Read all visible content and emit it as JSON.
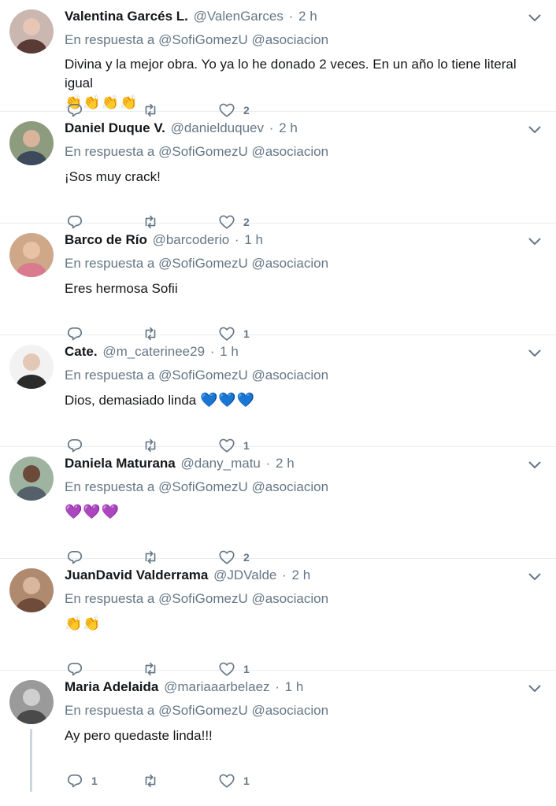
{
  "reply_prefix": "En respuesta a",
  "reply_targets": [
    "@SofiGomezU",
    "@asociacion"
  ],
  "tweets": [
    {
      "name": "Valentina Garcés L.",
      "handle": "@ValenGarces",
      "time": "2 h",
      "text": "Divina y la mejor obra. Yo ya lo he donado 2 veces. En un año lo tiene literal igual",
      "emoji": "👏👏👏👏",
      "replies": "",
      "retweets": "",
      "likes": "2"
    },
    {
      "name": "Daniel Duque V.",
      "handle": "@danielduquev",
      "time": "2 h",
      "text": "¡Sos muy crack!",
      "emoji": "",
      "replies": "",
      "retweets": "",
      "likes": "2"
    },
    {
      "name": "Barco de Río",
      "handle": "@barcoderio",
      "time": "1 h",
      "text": "Eres hermosa Sofii",
      "emoji": "",
      "replies": "",
      "retweets": "",
      "likes": "1"
    },
    {
      "name": "Cate.",
      "handle": "@m_caterinee29",
      "time": "1 h",
      "text": "Dios, demasiado linda",
      "emoji": "💙💙💙",
      "replies": "",
      "retweets": "",
      "likes": "1"
    },
    {
      "name": "Daniela Maturana",
      "handle": "@dany_matu",
      "time": "2 h",
      "text": "",
      "emoji": "💜💜💜",
      "replies": "",
      "retweets": "",
      "likes": "2"
    },
    {
      "name": "JuanDavid Valderrama",
      "handle": "@JDValde",
      "time": "2 h",
      "text": "",
      "emoji": "👏👏",
      "replies": "",
      "retweets": "",
      "likes": "1"
    },
    {
      "name": "Maria Adelaida",
      "handle": "@mariaaarbelaez",
      "time": "1 h",
      "text": "Ay pero quedaste linda!!!",
      "emoji": "",
      "replies": "1",
      "retweets": "",
      "likes": "1"
    }
  ],
  "icons": {
    "reply": "reply-icon",
    "retweet": "retweet-icon",
    "like": "heart-icon",
    "caret": "chevron-down-icon"
  },
  "colors": {
    "text": "#14171a",
    "muted": "#657786",
    "divider": "#e6ecf0",
    "icon": "#657786"
  }
}
